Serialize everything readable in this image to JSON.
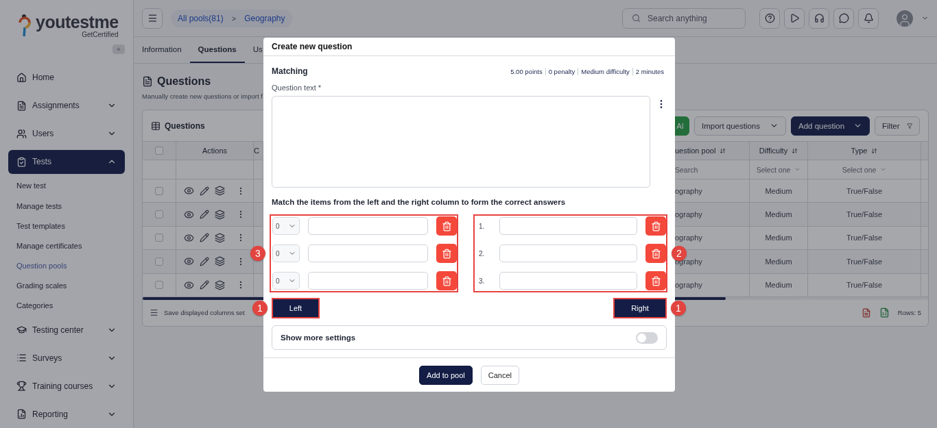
{
  "sidebar": {
    "logo": {
      "name": "youtestme",
      "tagline": "GetCertified"
    },
    "collapse": "«",
    "items": [
      {
        "label": "Home",
        "kind": "link",
        "selected": false
      },
      {
        "label": "Assignments",
        "kind": "group",
        "expanded": false,
        "selected": false
      },
      {
        "label": "Users",
        "kind": "group",
        "expanded": false,
        "selected": false
      },
      {
        "label": "Tests",
        "kind": "group",
        "expanded": true,
        "selected": true,
        "children": [
          {
            "label": "New test",
            "selected": false
          },
          {
            "label": "Manage tests",
            "selected": false
          },
          {
            "label": "Test templates",
            "selected": false
          },
          {
            "label": "Manage certificates",
            "selected": false
          },
          {
            "label": "Question pools",
            "selected": true
          },
          {
            "label": "Grading scales",
            "selected": false
          },
          {
            "label": "Categories",
            "selected": false
          }
        ]
      },
      {
        "label": "Testing center",
        "kind": "group",
        "expanded": false,
        "selected": false
      },
      {
        "label": "Surveys",
        "kind": "group",
        "expanded": false,
        "selected": false
      },
      {
        "label": "Training courses",
        "kind": "group",
        "expanded": false,
        "selected": false
      },
      {
        "label": "Reporting",
        "kind": "group",
        "expanded": false,
        "selected": false
      }
    ]
  },
  "topbar": {
    "breadcrumb": [
      "All pools(81)",
      "Geography"
    ],
    "separator": ">",
    "search": {
      "placeholder": "Search anything"
    }
  },
  "page_tabs": [
    {
      "label": "Information",
      "selected": false
    },
    {
      "label": "Questions",
      "selected": true
    },
    {
      "label": "Us",
      "selected": false
    }
  ],
  "page": {
    "title": "Questions",
    "description": "Manually create new questions or import f"
  },
  "table": {
    "title": "Questions",
    "toolbar": [
      {
        "label": "AI",
        "kind": "ai"
      },
      {
        "label": "Import questions",
        "kind": "dropdown"
      },
      {
        "label": "Add question",
        "kind": "primary"
      },
      {
        "label": "Filter",
        "kind": "filter"
      }
    ],
    "select_all": {
      "checked": false
    },
    "columns": [
      "Actions",
      "C",
      "uestion pool",
      "Difficulty",
      "Type"
    ],
    "filters": {
      "pool": "Search",
      "difficulty": "Select one",
      "type": "Select one"
    },
    "rows": [
      {
        "checked": false,
        "pool": "ography",
        "difficulty": "Medium",
        "type": "True/False"
      },
      {
        "checked": false,
        "pool": "ography",
        "difficulty": "Medium",
        "type": "True/False"
      },
      {
        "checked": false,
        "pool": "ography",
        "difficulty": "Medium",
        "type": "True/False"
      },
      {
        "checked": false,
        "pool": "ography",
        "difficulty": "Medium",
        "type": "True/False"
      },
      {
        "checked": false,
        "pool": "ography",
        "difficulty": "Medium",
        "type": "True/False"
      }
    ],
    "footer": {
      "save": "Save displayed columns set",
      "rows": "Rows: 5"
    }
  },
  "dialog": {
    "title": "Create new question",
    "type": "Matching",
    "meta": [
      "5.00 points",
      "0 penalty",
      "Medium difficulty",
      "2 minutes"
    ],
    "question_label": "Question text *",
    "instruction": "Match the items from the left and the right column to form the correct answers",
    "left_column": {
      "highlighted": true,
      "badge": "3",
      "rows": [
        {
          "order": "0"
        },
        {
          "order": "0"
        },
        {
          "order": "0"
        }
      ]
    },
    "right_column": {
      "highlighted": true,
      "badge": "2",
      "rows": [
        {
          "number": "1."
        },
        {
          "number": "2."
        },
        {
          "number": "3."
        }
      ]
    },
    "left_button": {
      "label": "Left",
      "highlighted": true,
      "badge": "1"
    },
    "right_button": {
      "label": "Right",
      "highlighted": true,
      "badge": "1"
    },
    "more_settings": {
      "label": "Show more settings",
      "on": false
    },
    "buttons": [
      {
        "label": "Add to pool",
        "kind": "primary"
      },
      {
        "label": "Cancel",
        "kind": "secondary"
      }
    ]
  }
}
